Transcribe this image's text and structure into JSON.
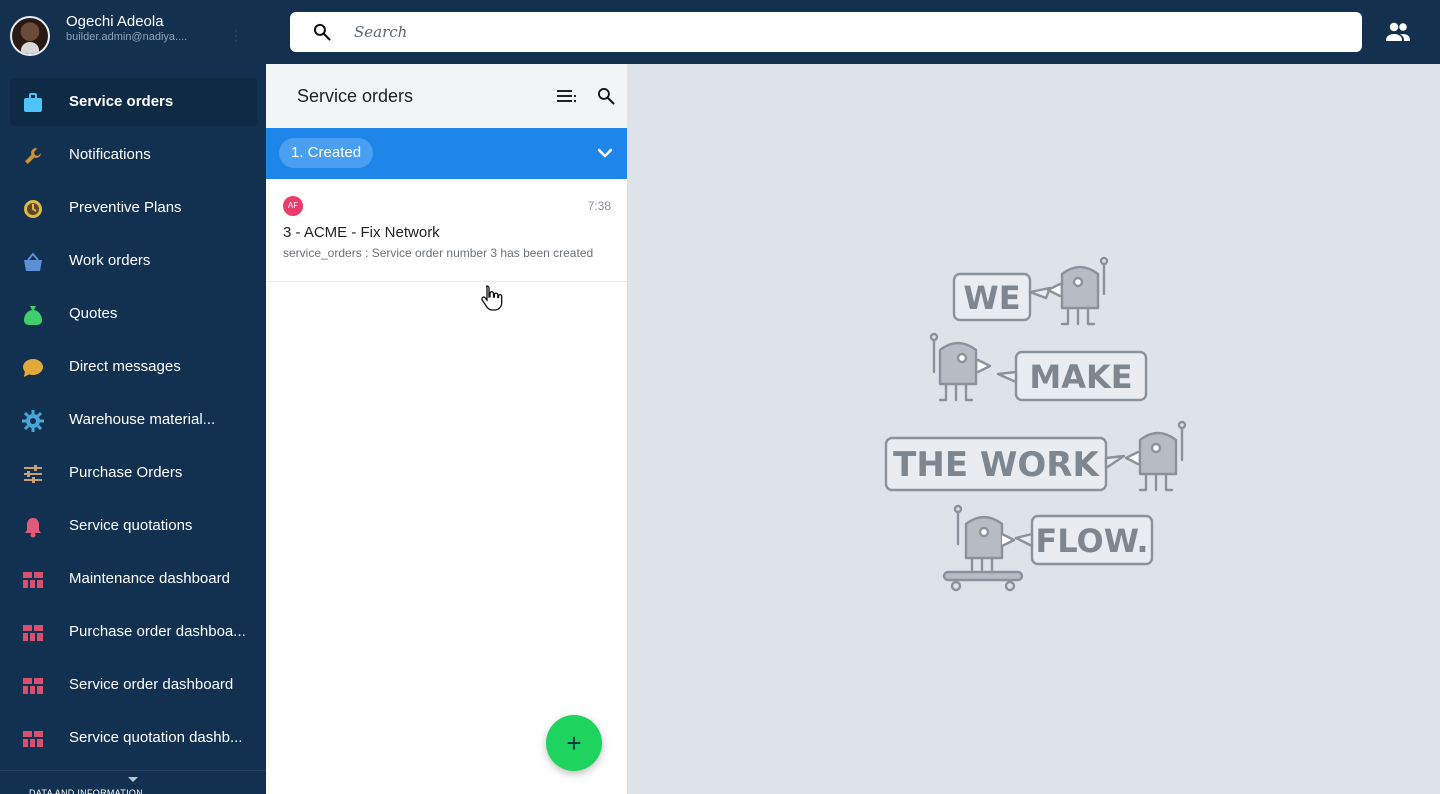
{
  "user": {
    "name": "Ogechi Adeola",
    "email": "builder.admin@nadiya...."
  },
  "search": {
    "placeholder": "Search"
  },
  "sidebar": {
    "items": [
      {
        "label": "Service orders",
        "icon": "briefcase-icon",
        "color": "#4fc3f7",
        "active": true
      },
      {
        "label": "Notifications",
        "icon": "wrench-icon",
        "color": "#c8913a"
      },
      {
        "label": "Preventive Plans",
        "icon": "clock-icon",
        "color": "#e0b84a"
      },
      {
        "label": "Work orders",
        "icon": "basket-icon",
        "color": "#5b8fd6"
      },
      {
        "label": "Quotes",
        "icon": "money-bag-icon",
        "color": "#3ecf6c"
      },
      {
        "label": "Direct messages",
        "icon": "chat-bubble-icon",
        "color": "#e2a93c"
      },
      {
        "label": "Warehouse material...",
        "icon": "gear-icon",
        "color": "#4aa8d8"
      },
      {
        "label": "Purchase Orders",
        "icon": "sliders-icon",
        "color": "#c8a078"
      },
      {
        "label": "Service quotations",
        "icon": "bell-icon",
        "color": "#e05a7a"
      },
      {
        "label": "Maintenance dashboard",
        "icon": "dashboard-icon",
        "color": "#d9506e"
      },
      {
        "label": "Purchase order dashboa...",
        "icon": "dashboard-icon",
        "color": "#d9506e"
      },
      {
        "label": "Service order dashboard",
        "icon": "dashboard-icon",
        "color": "#d9506e"
      },
      {
        "label": "Service quotation dashb...",
        "icon": "dashboard-icon",
        "color": "#d9506e"
      }
    ],
    "section_label": "DATA AND INFORMATION"
  },
  "list": {
    "title": "Service orders",
    "group": {
      "label": "1. Created"
    },
    "items": [
      {
        "badge": "AF",
        "time": "7:38",
        "title": "3 - ACME - Fix Network",
        "description": "service_orders : Service order number 3 has been created"
      }
    ],
    "fab_label": "+"
  },
  "illustration": {
    "lines": [
      "WE",
      "MAKE",
      "THE WORK",
      "FLOW."
    ]
  }
}
